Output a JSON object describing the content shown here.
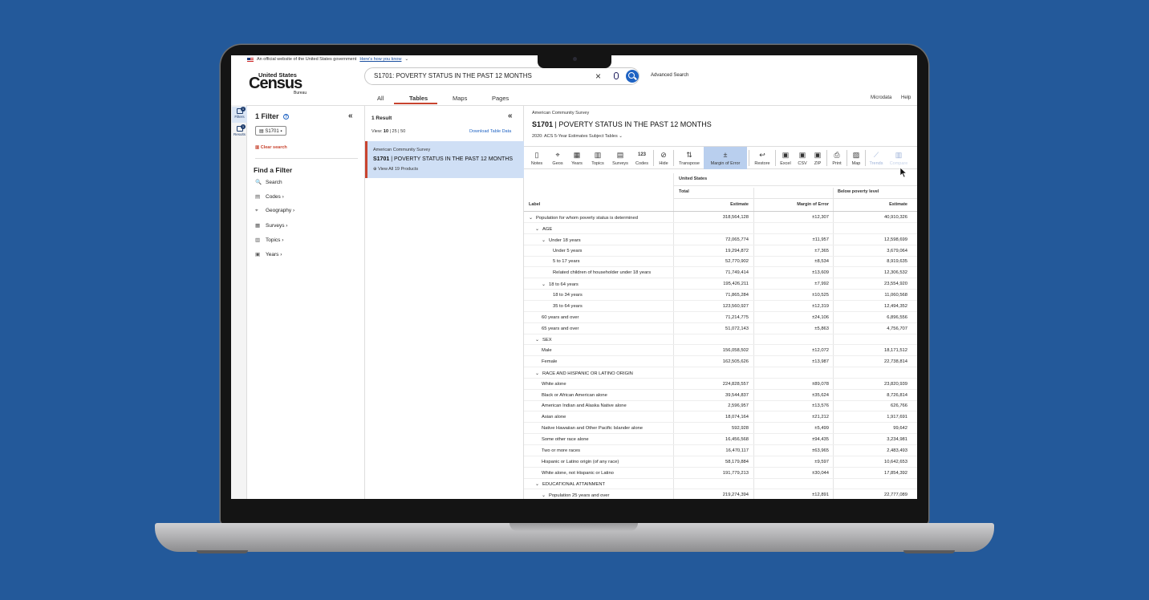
{
  "banner": {
    "text": "An official website of the United States government",
    "link": "Here's how you know"
  },
  "logo": {
    "line1": "United States",
    "line2": "Census",
    "line3": "Bureau"
  },
  "search": {
    "value": "S1701: POVERTY STATUS IN THE PAST 12 MONTHS",
    "clear": "×",
    "advanced": "Advanced Search"
  },
  "tabs": [
    {
      "label": "All"
    },
    {
      "label": "Tables"
    },
    {
      "label": "Maps"
    },
    {
      "label": "Pages"
    }
  ],
  "top_links": {
    "microdata": "Microdata",
    "help": "Help"
  },
  "rail": {
    "filters": "Filters",
    "filters_count": "1",
    "results": "Results",
    "results_count": "1"
  },
  "filters": {
    "title": "1 Filter",
    "help": "?",
    "collapse": "«",
    "chip": "S1701",
    "clear": "Clear search",
    "find_title": "Find a Filter",
    "items": [
      {
        "label": "Search",
        "icon": "🔍"
      },
      {
        "label": "Codes",
        "icon": "▤"
      },
      {
        "label": "Geography",
        "icon": "⌖"
      },
      {
        "label": "Surveys",
        "icon": "▦"
      },
      {
        "label": "Topics",
        "icon": "▥"
      },
      {
        "label": "Years",
        "icon": "▣"
      }
    ]
  },
  "results": {
    "title": "1 Result",
    "collapse": "«",
    "view_label": "View:",
    "view_10": "10",
    "view_25": "25",
    "view_50": "50",
    "download": "Download Table Data",
    "card": {
      "survey": "American Community Survey",
      "code": "S1701",
      "title": "POVERTY STATUS IN THE PAST 12 MONTHS",
      "products": "View All 19 Products"
    }
  },
  "table": {
    "survey": "American Community Survey",
    "code": "S1701",
    "title": "POVERTY STATUS IN THE PAST 12 MONTHS",
    "subtitle": "2020: ACS 5-Year Estimates Subject Tables",
    "toolbar": [
      {
        "label": "Notes"
      },
      {
        "label": "Geos"
      },
      {
        "label": "Years"
      },
      {
        "label": "Topics"
      },
      {
        "label": "Surveys"
      },
      {
        "label": "Codes"
      },
      {
        "label": "Hide"
      },
      {
        "label": "Transpose"
      },
      {
        "label": "Margin of Error"
      },
      {
        "label": "Restore"
      },
      {
        "label": "Excel"
      },
      {
        "label": "CSV"
      },
      {
        "label": "ZIP"
      },
      {
        "label": "Print"
      },
      {
        "label": "Map"
      },
      {
        "label": "Trends"
      },
      {
        "label": "Compare"
      }
    ],
    "codes_icon_text": "123",
    "geo_header": "United States",
    "total_header": "Total",
    "below_header": "Below poverty level",
    "col_label": "Label",
    "col_estimate": "Estimate",
    "col_moe": "Margin of Error",
    "col_estimate2": "Estimate",
    "rows": [
      {
        "label": "Population for whom poverty status is determined",
        "est": "318,564,128",
        "moe": "±12,307",
        "below": "40,910,326",
        "indent": 0,
        "chev": "v"
      },
      {
        "label": "AGE",
        "est": "",
        "moe": "",
        "below": "",
        "indent": 1,
        "chev": "v"
      },
      {
        "label": "Under 18 years",
        "est": "72,065,774",
        "moe": "±11,957",
        "below": "12,598,699",
        "indent": 2,
        "chev": "v"
      },
      {
        "label": "Under 5 years",
        "est": "19,294,872",
        "moe": "±7,365",
        "below": "3,679,064",
        "indent": 3,
        "chev": ""
      },
      {
        "label": "5 to 17 years",
        "est": "52,770,902",
        "moe": "±8,534",
        "below": "8,919,635",
        "indent": 3,
        "chev": ""
      },
      {
        "label": "Related children of householder under 18 years",
        "est": "71,749,414",
        "moe": "±13,609",
        "below": "12,306,532",
        "indent": 3,
        "chev": ""
      },
      {
        "label": "18 to 64 years",
        "est": "195,426,211",
        "moe": "±7,992",
        "below": "23,554,920",
        "indent": 2,
        "chev": "v"
      },
      {
        "label": "18 to 34 years",
        "est": "71,865,284",
        "moe": "±10,525",
        "below": "11,060,568",
        "indent": 3,
        "chev": ""
      },
      {
        "label": "35 to 64 years",
        "est": "123,560,927",
        "moe": "±12,319",
        "below": "12,494,352",
        "indent": 3,
        "chev": ""
      },
      {
        "label": "60 years and over",
        "est": "71,214,775",
        "moe": "±24,106",
        "below": "6,896,556",
        "indent": 2,
        "chev": ""
      },
      {
        "label": "65 years and over",
        "est": "51,072,143",
        "moe": "±5,863",
        "below": "4,756,707",
        "indent": 2,
        "chev": ""
      },
      {
        "label": "SEX",
        "est": "",
        "moe": "",
        "below": "",
        "indent": 1,
        "chev": "v"
      },
      {
        "label": "Male",
        "est": "156,058,502",
        "moe": "±12,072",
        "below": "18,171,512",
        "indent": 2,
        "chev": ""
      },
      {
        "label": "Female",
        "est": "162,505,626",
        "moe": "±13,987",
        "below": "22,738,814",
        "indent": 2,
        "chev": ""
      },
      {
        "label": "RACE AND HISPANIC OR LATINO ORIGIN",
        "est": "",
        "moe": "",
        "below": "",
        "indent": 1,
        "chev": "v"
      },
      {
        "label": "White alone",
        "est": "224,828,557",
        "moe": "±89,078",
        "below": "23,820,939",
        "indent": 2,
        "chev": ""
      },
      {
        "label": "Black or African American alone",
        "est": "39,544,837",
        "moe": "±35,624",
        "below": "8,726,814",
        "indent": 2,
        "chev": ""
      },
      {
        "label": "American Indian and Alaska Native alone",
        "est": "2,596,957",
        "moe": "±13,576",
        "below": "626,766",
        "indent": 2,
        "chev": ""
      },
      {
        "label": "Asian alone",
        "est": "18,074,164",
        "moe": "±21,212",
        "below": "1,917,691",
        "indent": 2,
        "chev": ""
      },
      {
        "label": "Native Hawaiian and Other Pacific Islander alone",
        "est": "592,928",
        "moe": "±5,499",
        "below": "99,642",
        "indent": 2,
        "chev": ""
      },
      {
        "label": "Some other race alone",
        "est": "16,456,568",
        "moe": "±94,435",
        "below": "3,234,981",
        "indent": 2,
        "chev": ""
      },
      {
        "label": "Two or more races",
        "est": "16,470,117",
        "moe": "±63,965",
        "below": "2,483,493",
        "indent": 2,
        "chev": ""
      },
      {
        "label": "Hispanic or Latino origin (of any race)",
        "est": "58,179,884",
        "moe": "±9,597",
        "below": "10,642,653",
        "indent": 2,
        "chev": ""
      },
      {
        "label": "White alone, not Hispanic or Latino",
        "est": "191,779,213",
        "moe": "±30,044",
        "below": "17,854,392",
        "indent": 2,
        "chev": ""
      },
      {
        "label": "EDUCATIONAL ATTAINMENT",
        "est": "",
        "moe": "",
        "below": "",
        "indent": 1,
        "chev": "v"
      },
      {
        "label": "Population 25 years and over",
        "est": "219,274,394",
        "moe": "±12,891",
        "below": "22,777,089",
        "indent": 2,
        "chev": "v"
      }
    ]
  },
  "colors": {
    "accent": "#c8442f",
    "brand_blue": "#1f63c3",
    "selected": "#cfdff5",
    "background": "#23599a"
  }
}
